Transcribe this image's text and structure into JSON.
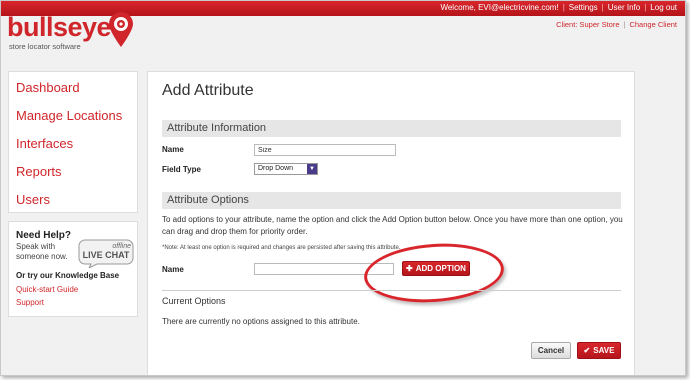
{
  "header": {
    "welcome": "Welcome, EVI@electricvine.com!",
    "settings_link": "Settings",
    "user_info_link": "User Info",
    "logout_link": "Log out",
    "client_label": "Client: Super Store",
    "change_client_link": "Change Client",
    "brand_color": "#d0262b"
  },
  "logo": {
    "wordmark": "bullseye",
    "tagline": "store locator software"
  },
  "sidebar": {
    "items": [
      {
        "label": "Dashboard"
      },
      {
        "label": "Manage Locations"
      },
      {
        "label": "Interfaces"
      },
      {
        "label": "Reports"
      },
      {
        "label": "Users"
      }
    ]
  },
  "help": {
    "title": "Need Help?",
    "line1": "Speak with",
    "line2": "someone now.",
    "chat_status": "offline",
    "chat_label": "LIVE CHAT",
    "kb_title": "Or try our Knowledge Base",
    "link_guide": "Quick-start Guide",
    "link_support": "Support"
  },
  "main": {
    "title": "Add Attribute",
    "info_section": "Attribute Information",
    "name_label": "Name",
    "name_value": "Size",
    "field_type_label": "Field Type",
    "field_type_value": "Drop Down",
    "options_section": "Attribute Options",
    "options_desc": "To add options to your attribute, name the option and click the Add Option button below. Once you have more than one option, you can drag and drop them for priority order.",
    "options_note": "*Note: At least one option is required and changes are persisted after saving this attribute.",
    "option_name_label": "Name",
    "option_name_value": "",
    "add_option_button": "ADD OPTION",
    "current_options_title": "Current Options",
    "no_options_text": "There are currently no options assigned to this attribute.",
    "cancel_button": "Cancel",
    "save_button": "SAVE"
  }
}
